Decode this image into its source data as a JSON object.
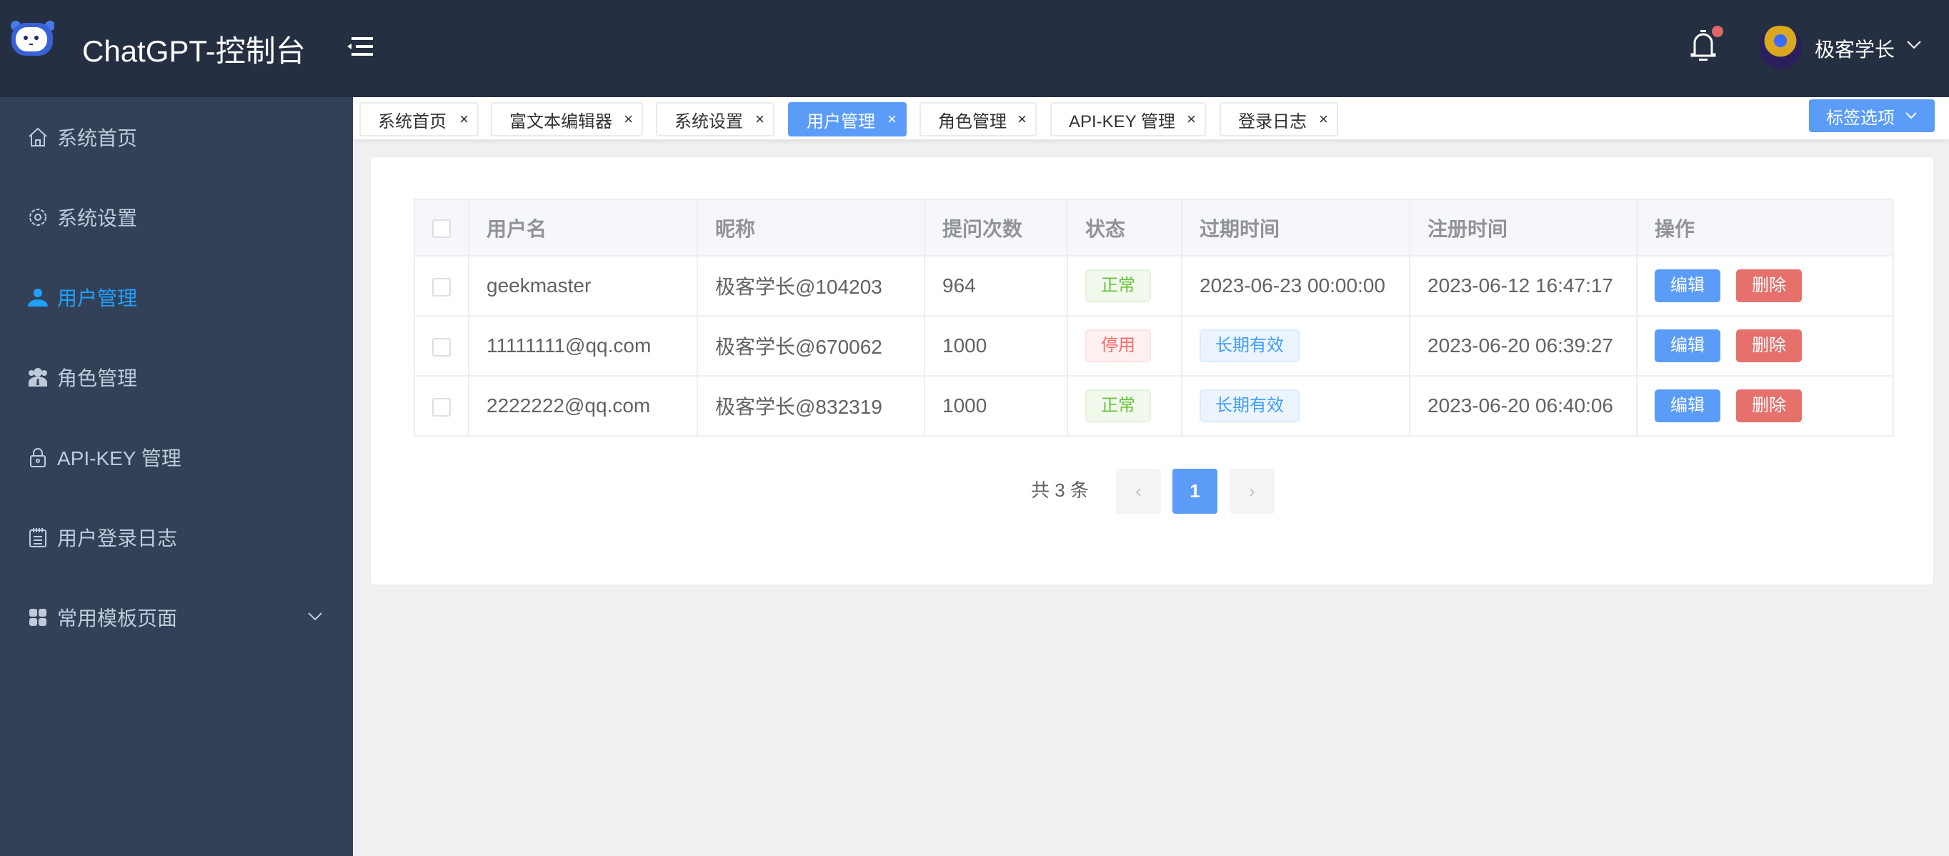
{
  "header": {
    "title": "ChatGPT-控制台",
    "user_name": "极客学长",
    "logo_icon": "robot-logo-icon",
    "notification_badge": true
  },
  "sidebar": {
    "items": [
      {
        "label": "系统首页",
        "icon": "home-icon"
      },
      {
        "label": "系统设置",
        "icon": "gear-icon"
      },
      {
        "label": "用户管理",
        "icon": "user-icon",
        "active": true
      },
      {
        "label": "角色管理",
        "icon": "users-role-icon"
      },
      {
        "label": "API-KEY 管理",
        "icon": "lock-icon"
      },
      {
        "label": "用户登录日志",
        "icon": "notepad-icon"
      },
      {
        "label": "常用模板页面",
        "icon": "grid-icon",
        "has_submenu": true
      }
    ]
  },
  "tabs": {
    "items": [
      {
        "label": "系统首页"
      },
      {
        "label": "富文本编辑器"
      },
      {
        "label": "系统设置"
      },
      {
        "label": "用户管理",
        "active": true
      },
      {
        "label": "角色管理"
      },
      {
        "label": "API-KEY 管理"
      },
      {
        "label": "登录日志"
      }
    ],
    "options_label": "标签选项"
  },
  "table": {
    "columns": [
      "用户名",
      "昵称",
      "提问次数",
      "状态",
      "过期时间",
      "注册时间",
      "操作"
    ],
    "rows": [
      {
        "username": "geekmaster",
        "nickname": "极客学长@104203",
        "count": "964",
        "status": "正常",
        "status_type": "ok",
        "expire": "2023-06-23 00:00:00",
        "expire_tag": false,
        "registered": "2023-06-12 16:47:17"
      },
      {
        "username": "11111111@qq.com",
        "nickname": "极客学长@670062",
        "count": "1000",
        "status": "停用",
        "status_type": "stop",
        "expire": "长期有效",
        "expire_tag": true,
        "registered": "2023-06-20 06:39:27"
      },
      {
        "username": "2222222@qq.com",
        "nickname": "极客学长@832319",
        "count": "1000",
        "status": "正常",
        "status_type": "ok",
        "expire": "长期有效",
        "expire_tag": true,
        "registered": "2023-06-20 06:40:06"
      }
    ],
    "edit_label": "编辑",
    "delete_label": "删除"
  },
  "pagination": {
    "total_text": "共 3 条",
    "current_page": "1",
    "prev": "‹",
    "next": "›"
  },
  "colors": {
    "header_bg": "#242f42",
    "sidebar_bg": "#324157",
    "accent": "#5a9cf8",
    "active_menu": "#20a0ff",
    "danger": "#e5706c"
  }
}
